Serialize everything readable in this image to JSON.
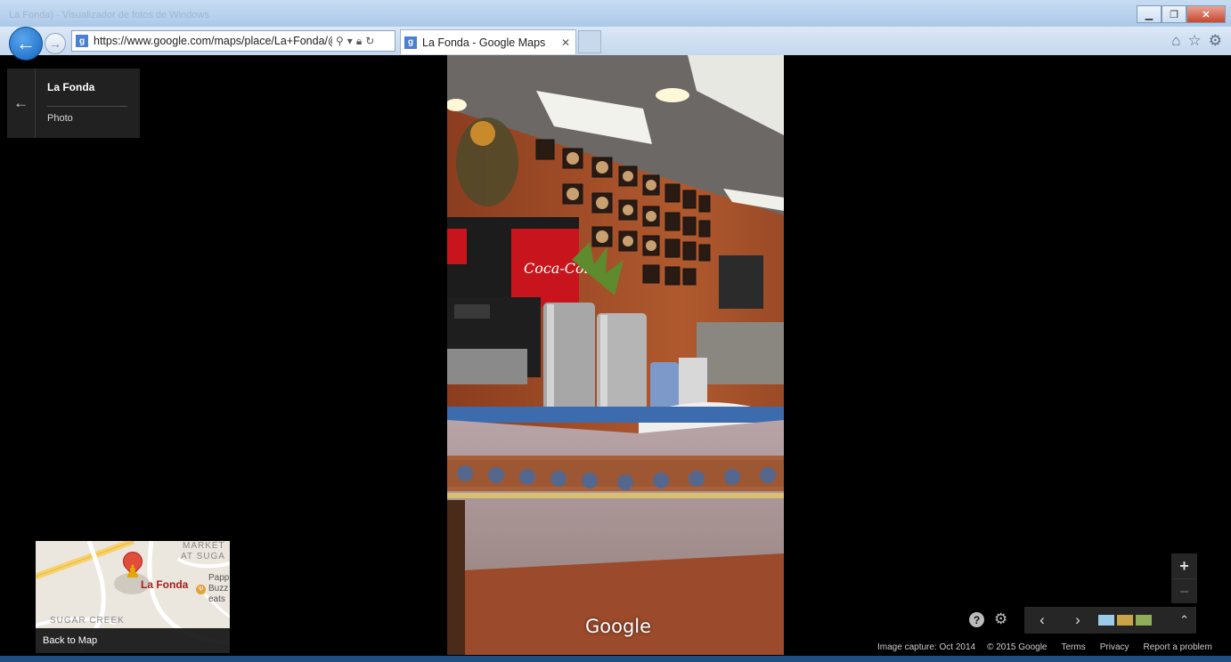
{
  "window": {
    "ghost_title": "La Fonda) - Visualizador de fotos de Windows",
    "minimize_icon": "minimize-icon",
    "restore_icon": "restore-icon",
    "close_icon": "close-icon"
  },
  "browser": {
    "url": "https://www.google.com/maps/place/La+Fonda/@",
    "tab_title": "La Fonda - Google Maps",
    "tab_favicon": "g"
  },
  "place_card": {
    "name": "La Fonda",
    "type": "Photo"
  },
  "photo": {
    "watermark": "Google",
    "brand_sign": "Coca-Cola"
  },
  "minimap": {
    "place_label": "La Fonda",
    "area_label_1": "MARKET",
    "area_label_2": "AT SUGA",
    "area_label_3": "SUGAR CREEK",
    "poi_line_1": "Papp",
    "poi_line_2": "Buzz",
    "poi_line_3": "eats",
    "back_label": "Back to Map"
  },
  "controls": {
    "zoom_in": "+",
    "zoom_out": "−",
    "help": "?",
    "prev": "‹",
    "next": "›",
    "expand": "⌃"
  },
  "footer": {
    "capture": "Image capture: Oct 2014",
    "copyright": "© 2015 Google",
    "terms": "Terms",
    "privacy": "Privacy",
    "report": "Report a problem"
  }
}
